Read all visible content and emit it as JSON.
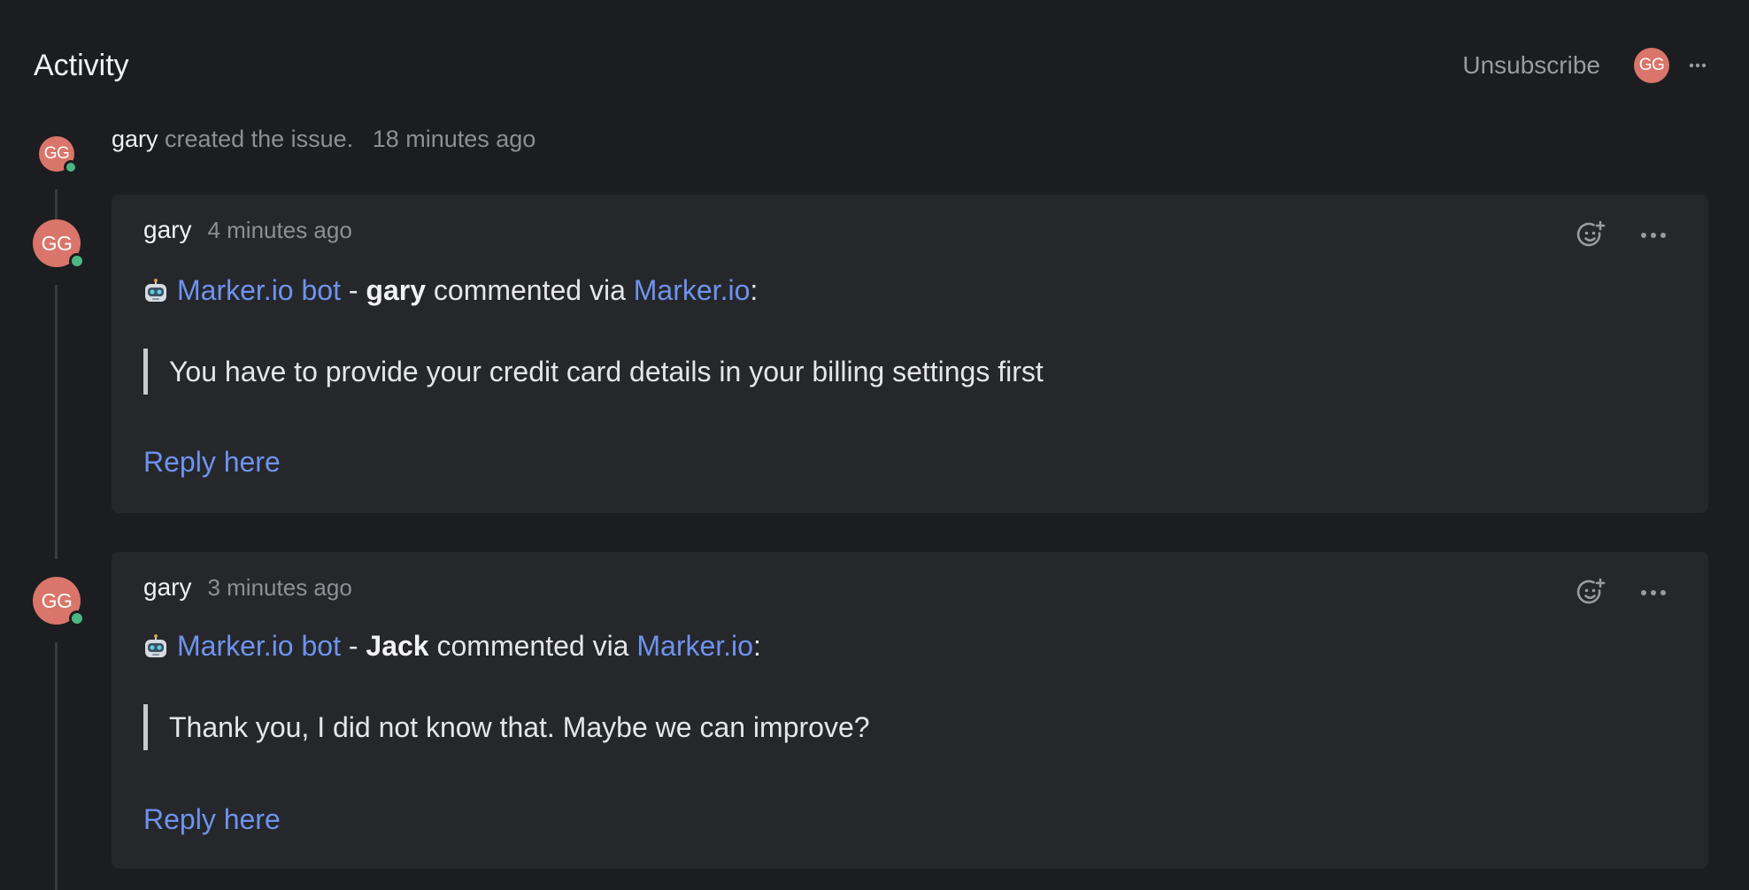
{
  "header": {
    "title": "Activity",
    "unsubscribe_label": "Unsubscribe",
    "avatar_initials": "GG"
  },
  "created_event": {
    "avatar_initials": "GG",
    "actor": "gary",
    "action": "created the issue.",
    "time_ago": "18 minutes ago"
  },
  "comments": [
    {
      "avatar_initials": "GG",
      "author": "gary",
      "time_ago": "4 minutes ago",
      "bot_label": "Marker.io bot",
      "separator": "-",
      "commenter": "gary",
      "via_text": "commented via",
      "via_link": "Marker.io",
      "colon": ":",
      "quote": "You have to provide your credit card details in your billing settings first",
      "reply_label": "Reply here"
    },
    {
      "avatar_initials": "GG",
      "author": "gary",
      "time_ago": "3 minutes ago",
      "bot_label": "Marker.io bot",
      "separator": "-",
      "commenter": "Jack",
      "via_text": "commented via",
      "via_link": "Marker.io",
      "colon": ":",
      "quote": "Thank you, I did not know that. Maybe we can improve?",
      "reply_label": "Reply here"
    }
  ],
  "icons": {
    "add_reaction": "add-reaction-icon",
    "more": "more-horizontal-icon",
    "bot": "robot-icon"
  },
  "colors": {
    "background": "#1c1d20",
    "card": "#26272b",
    "link": "#6e93ee",
    "avatar": "#d9756a",
    "online": "#4cb782"
  }
}
